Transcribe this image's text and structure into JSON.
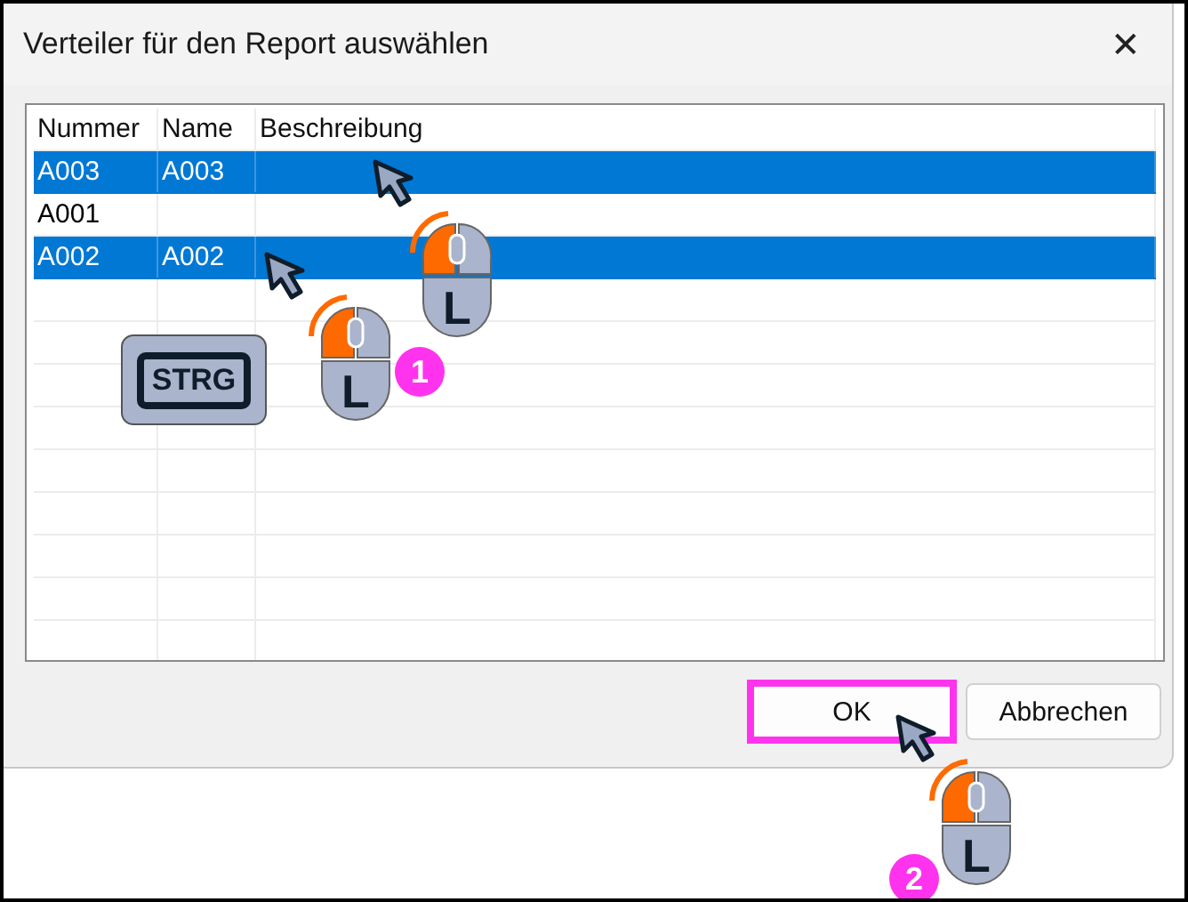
{
  "window": {
    "title": "Verteiler für den Report auswählen",
    "close": "✕"
  },
  "table": {
    "columns": [
      "Nummer",
      "Name",
      "Beschreibung"
    ],
    "rows": [
      {
        "cells": [
          "A003",
          "A003",
          ""
        ],
        "selected": true
      },
      {
        "cells": [
          "A001",
          "",
          ""
        ],
        "selected": false
      },
      {
        "cells": [
          "A002",
          "A002",
          ""
        ],
        "selected": true
      }
    ]
  },
  "buttons": [
    {
      "label": "OK",
      "highlighted": true
    },
    {
      "label": "Abbrechen",
      "highlighted": false
    }
  ],
  "annotations": [
    {
      "kind": "cursor"
    },
    {
      "kind": "mouse",
      "label": "L"
    },
    {
      "kind": "cursor"
    },
    {
      "kind": "key",
      "label": "STRG"
    },
    {
      "kind": "mouse",
      "label": "L"
    },
    {
      "kind": "badge",
      "label": "1"
    },
    {
      "kind": "cursor"
    },
    {
      "kind": "mouse",
      "label": "L"
    },
    {
      "kind": "badge",
      "label": "2"
    }
  ]
}
